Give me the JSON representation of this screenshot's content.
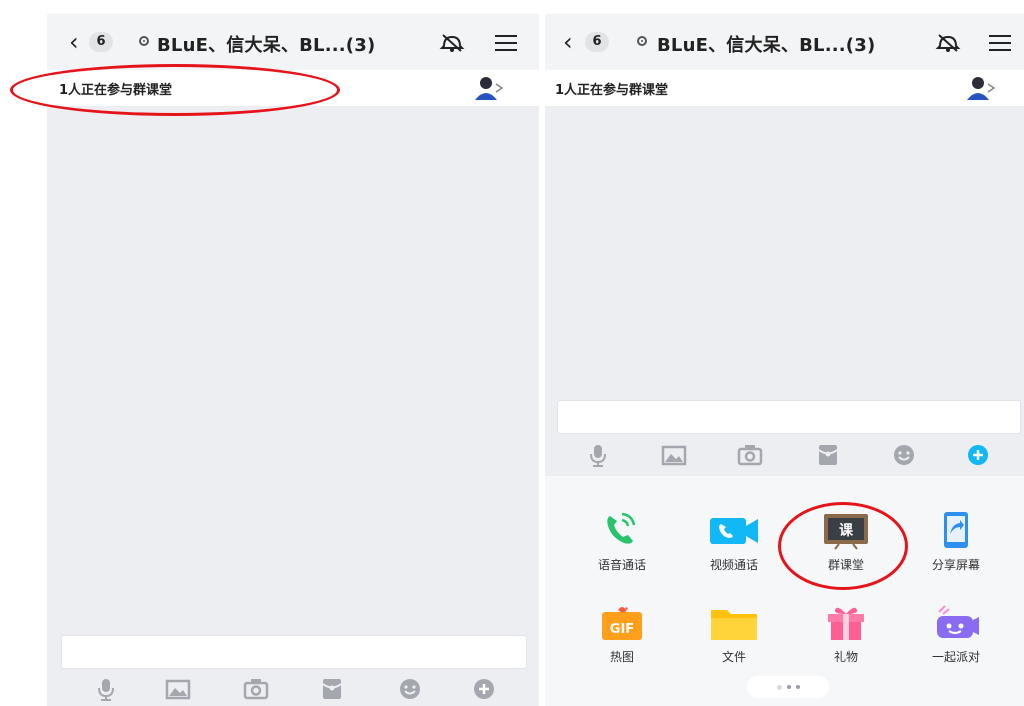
{
  "header": {
    "unread_count": "6",
    "group_title": "BLuE、信大呆、BL...(3)"
  },
  "notice": {
    "text": "1人正在参与群课堂"
  },
  "toolbar": {
    "icons": [
      "microphone-icon",
      "image-icon",
      "camera-icon",
      "red-envelope-icon",
      "emoji-icon",
      "plus-icon"
    ]
  },
  "panel": {
    "functions": [
      {
        "label": "语音通话",
        "icon": "voice-call-icon",
        "color": "#27c46b"
      },
      {
        "label": "视频通话",
        "icon": "video-call-icon",
        "color": "#12b7f5"
      },
      {
        "label": "群课堂",
        "icon": "group-classroom-icon",
        "color": "#8a6a4a"
      },
      {
        "label": "分享屏幕",
        "icon": "share-screen-icon",
        "color": "#2e8ff0"
      },
      {
        "label": "热图",
        "icon": "gif-icon",
        "color": "#ff9f1a"
      },
      {
        "label": "文件",
        "icon": "folder-icon",
        "color": "#ffc20e"
      },
      {
        "label": "礼物",
        "icon": "gift-icon",
        "color": "#ff5f92"
      },
      {
        "label": "一起派对",
        "icon": "party-icon",
        "color": "#8a6cf2"
      }
    ]
  },
  "colors": {
    "annotation_red": "#e5141a",
    "accent_blue": "#12b7f5"
  }
}
